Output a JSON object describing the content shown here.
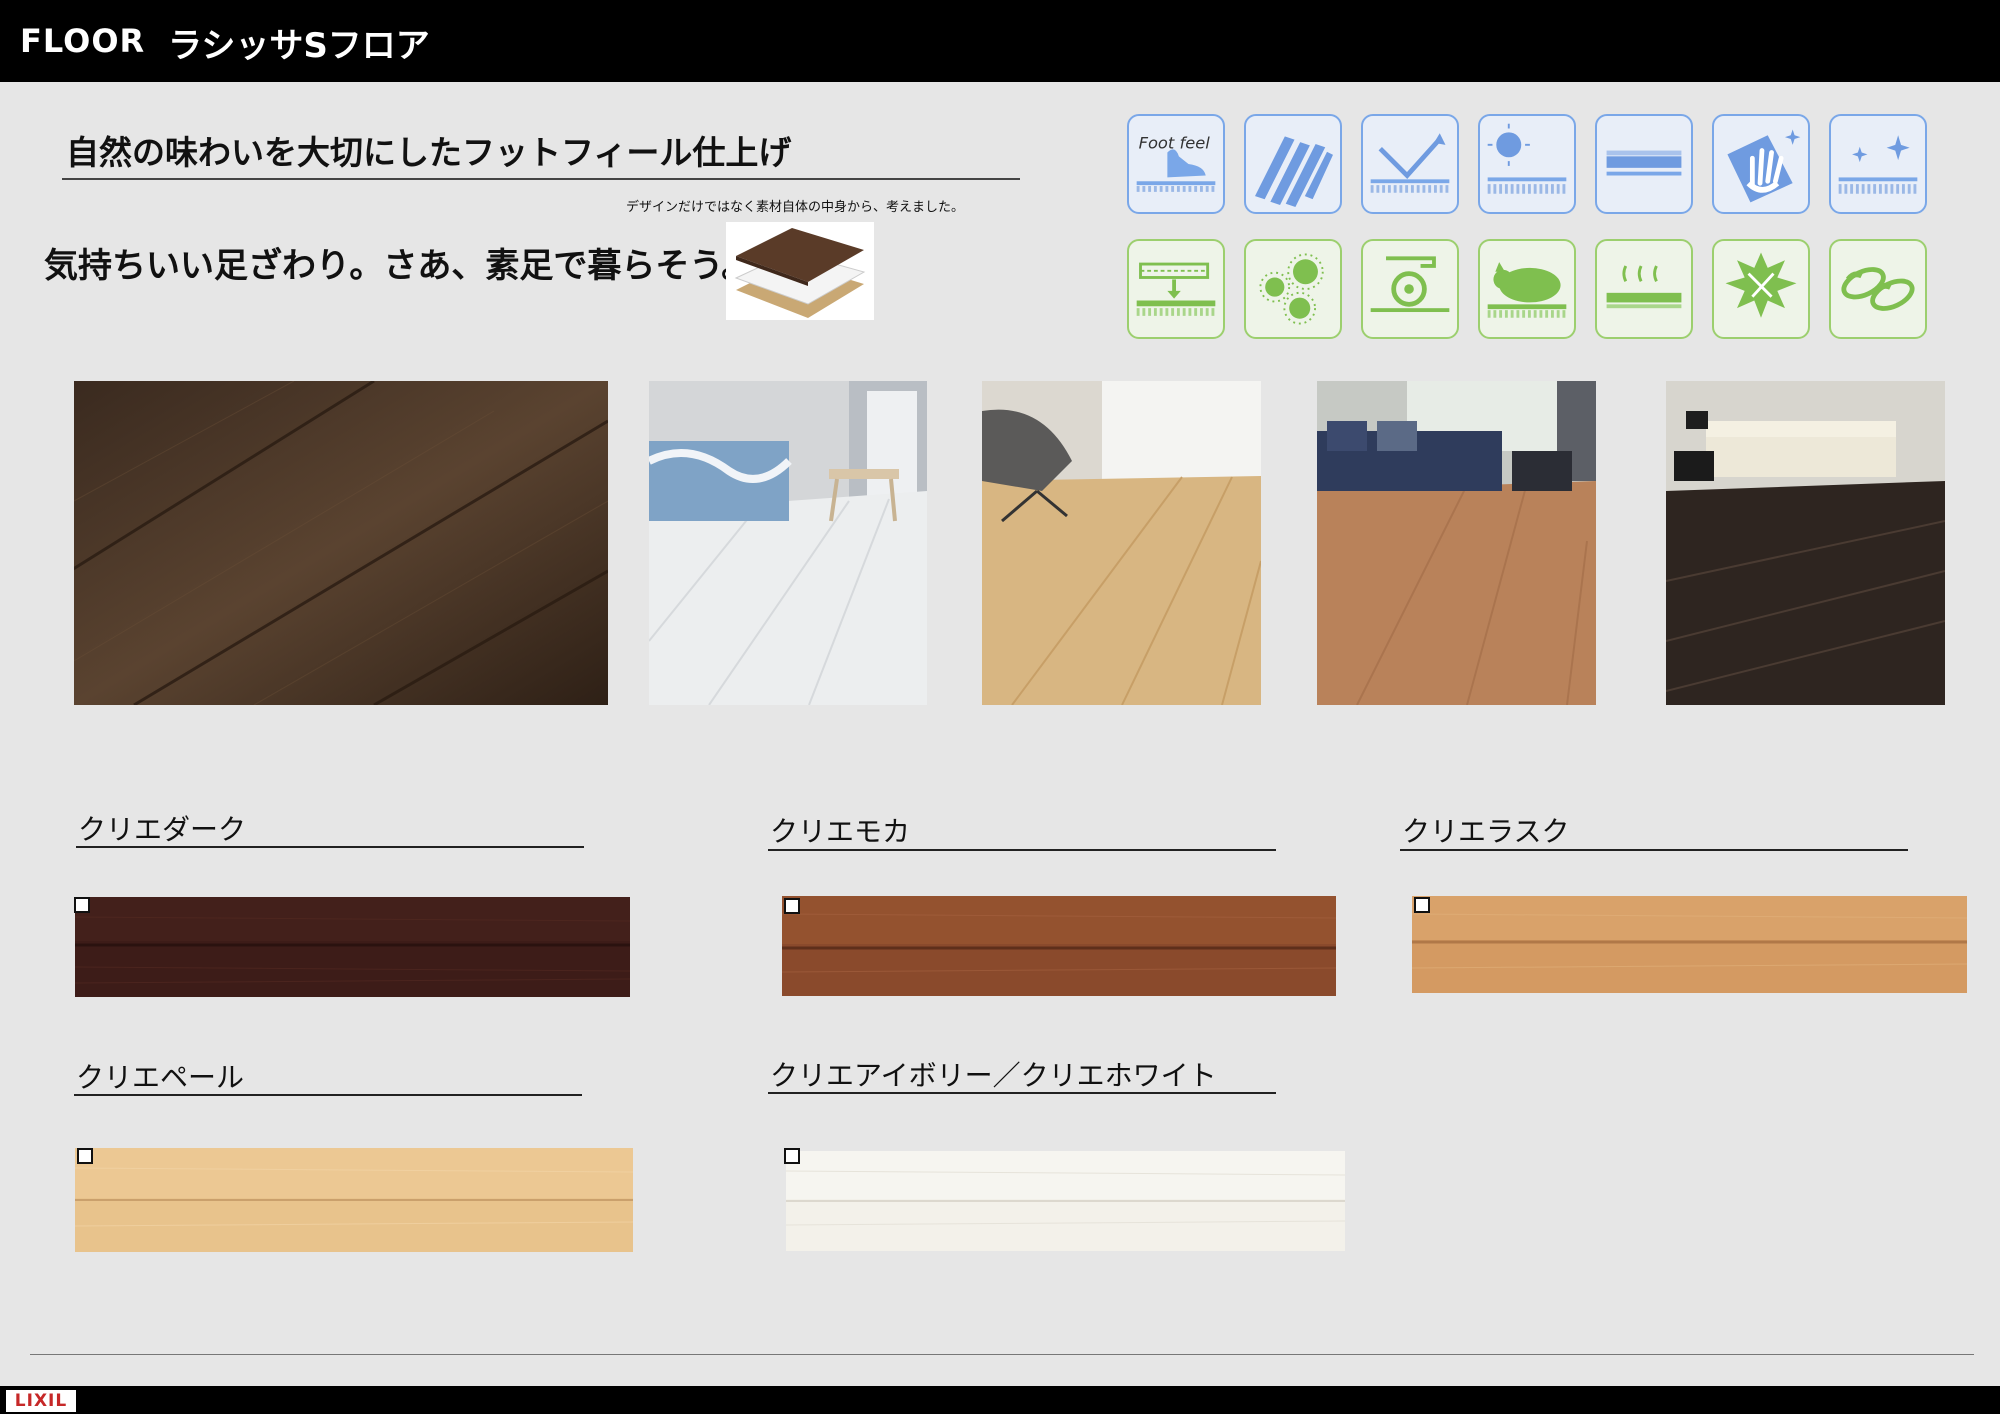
{
  "header": {
    "section": "FLOOR",
    "product": "ラシッサSフロア"
  },
  "headline": "自然の味わいを大切にしたフットフィール仕上げ",
  "design_note": "デザインだけではなく素材自体の中身から、考えました。",
  "tagline": "気持ちいい足ざわり。さあ、素足で暮らそう。",
  "feature_icons": {
    "top_row": [
      "foot-feel-icon",
      "wood-planks-icon",
      "reflection-icon",
      "sun-fade-icon",
      "surface-layer-icon",
      "hand-clean-icon",
      "sparkle-icon"
    ],
    "bottom_row": [
      "press-layer-icon",
      "anti-bacteria-icon",
      "caster-icon",
      "pet-icon",
      "floor-heating-icon",
      "anti-scratch-icon",
      "slippers-icon"
    ],
    "foot_feel_text": "Foot feel",
    "colors": {
      "blue": "#7aa7e8",
      "green": "#9ccf6e"
    }
  },
  "photos": [
    "dark-wood-closeup",
    "white-bedroom",
    "light-living-room",
    "medium-living-room",
    "dark-living-room"
  ],
  "swatches": [
    {
      "name": "クリエダーク",
      "color": "#3d1c18"
    },
    {
      "name": "クリエモカ",
      "color": "#8a4a2c"
    },
    {
      "name": "クリエラスク",
      "color": "#d49a62"
    },
    {
      "name": "クリエペール",
      "color": "#e8c38c"
    },
    {
      "name": "クリエアイボリー／クリエホワイト",
      "color": "#f3f1ea"
    }
  ],
  "footer": {
    "logo": "LIXIL"
  }
}
